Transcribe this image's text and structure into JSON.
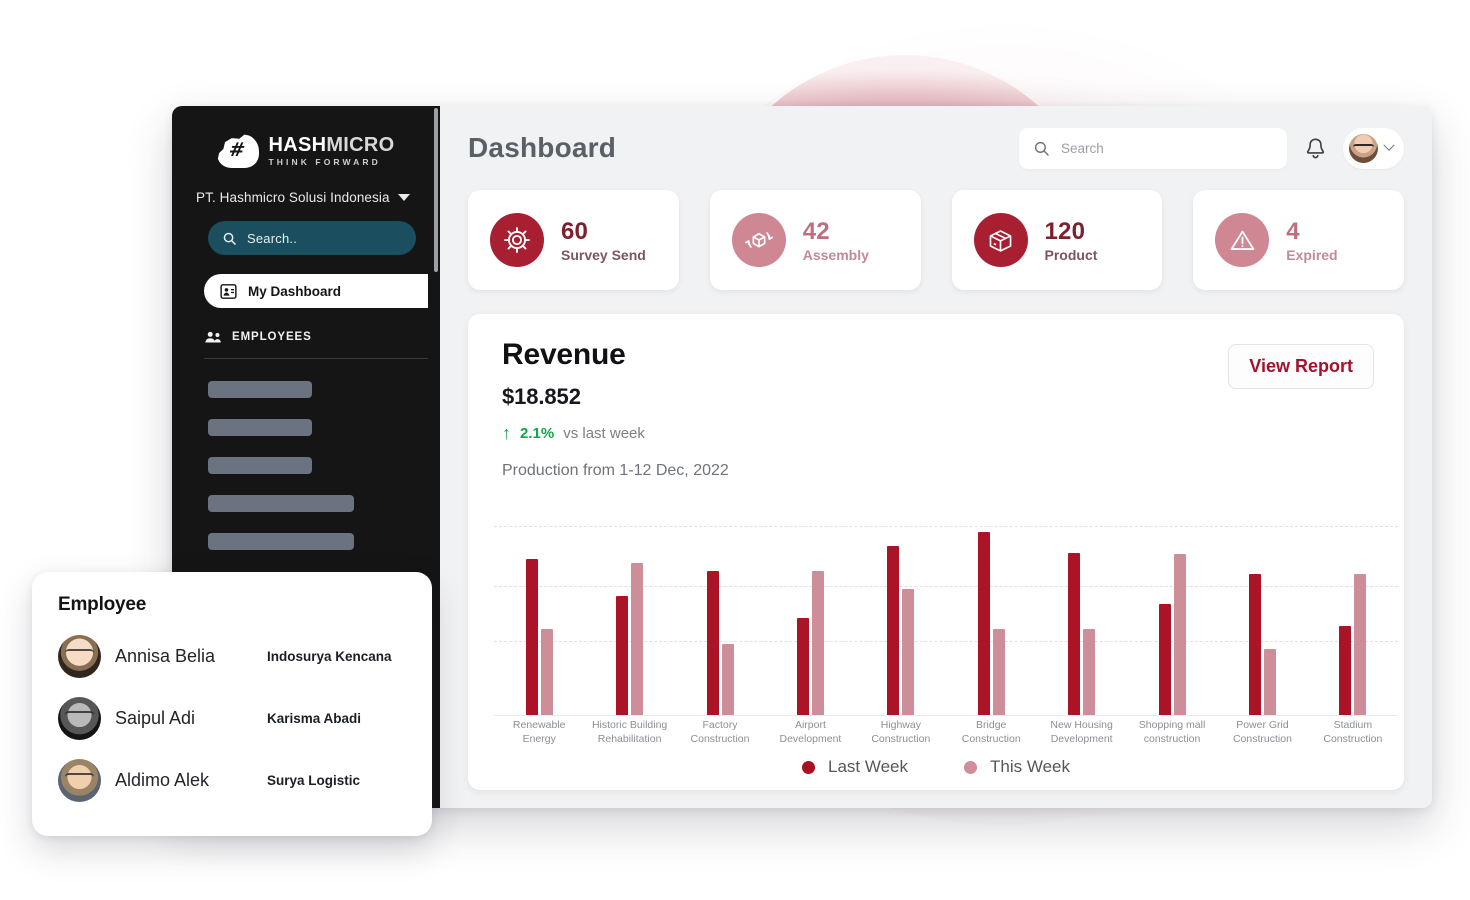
{
  "sidebar": {
    "brand": {
      "word1": "HASH",
      "word2": "MICRO",
      "tagline": "THINK FORWARD",
      "mark_glyph": "#"
    },
    "company": "PT. Hashmicro Solusi Indonesia",
    "search_placeholder": "Search..",
    "nav_active": "My Dashboard",
    "section_employees": "EMPLOYEES",
    "skeleton_widths": [
      "104px",
      "104px",
      "104px",
      "146px",
      "146px"
    ]
  },
  "topbar": {
    "title": "Dashboard",
    "search_placeholder": "Search"
  },
  "stats": [
    {
      "value": "60",
      "label": "Survey Send",
      "icon": "gear-icon",
      "tone": "dark"
    },
    {
      "value": "42",
      "label": "Assembly",
      "icon": "recycle-box-icon",
      "tone": "light"
    },
    {
      "value": "120",
      "label": "Product",
      "icon": "box-icon",
      "tone": "dark"
    },
    {
      "value": "4",
      "label": "Expired",
      "icon": "warning-icon",
      "tone": "light"
    }
  ],
  "revenue": {
    "title": "Revenue",
    "amount": "$18.852",
    "delta_pct": "2.1%",
    "delta_compare": "vs last week",
    "subtitle": "Production from 1-12 Dec, 2022",
    "view_report": "View Report"
  },
  "chart_data": {
    "type": "bar",
    "title": "Revenue",
    "subtitle": "Production from 1-12 Dec, 2022",
    "xlabel": "",
    "ylabel": "",
    "ylim": [
      0,
      160
    ],
    "grid": true,
    "gridlines_y": [
      40,
      80,
      130
    ],
    "legend_position": "bottom-center",
    "categories": [
      "Renewable Energy",
      "Historic Building Rehabilitation",
      "Factory Construction",
      "Airport Development",
      "Highway Construction",
      "Bridge Construction",
      "New Housing Development",
      "Shopping mall construction",
      "Power Grid Construction",
      "Stadium Construction"
    ],
    "series": [
      {
        "name": "Last Week",
        "color": "#ab1326",
        "values": [
          132,
          101,
          122,
          82,
          143,
          155,
          137,
          94,
          119,
          75
        ]
      },
      {
        "name": "This Week",
        "color": "#ce8e99",
        "values": [
          73,
          129,
          60,
          122,
          107,
          73,
          73,
          136,
          56,
          119
        ]
      }
    ]
  },
  "legend": [
    {
      "label": "Last Week",
      "color": "#a80f23"
    },
    {
      "label": "This Week",
      "color": "#cf8e99"
    }
  ],
  "employee_panel": {
    "title": "Employee",
    "rows": [
      {
        "name": "Annisa Belia",
        "company": "Indosurya Kencana"
      },
      {
        "name": "Saipul Adi",
        "company": "Karisma Abadi"
      },
      {
        "name": "Aldimo Alek",
        "company": "Surya Logistic"
      }
    ]
  },
  "colors": {
    "brand_red": "#a81f31",
    "brand_red_light": "#cf8794",
    "accent_link": "#a4112c",
    "positive": "#16a34a",
    "sidebar_bg": "#151515",
    "sidebar_search": "#1b4e5e"
  }
}
